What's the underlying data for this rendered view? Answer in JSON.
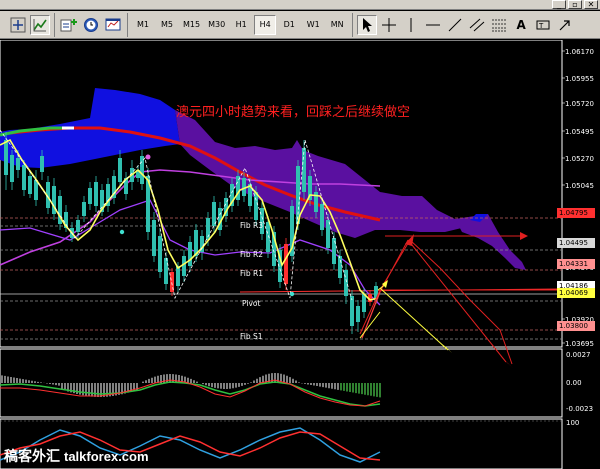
{
  "window": {
    "minimize_glyph": "_",
    "restore_glyph": "▫",
    "close_glyph": "✕"
  },
  "toolbar": {
    "icons": [
      "crosshair-box-icon",
      "line-chart-icon",
      "new-order-icon",
      "clock-icon",
      "template-icon"
    ],
    "timeframes": [
      "M1",
      "M5",
      "M15",
      "M30",
      "H1",
      "H4",
      "D1",
      "W1",
      "MN"
    ],
    "active_timeframe": "H4",
    "tools": [
      "cursor-icon",
      "crosshair-icon",
      "vertical-line-icon",
      "horizontal-line-icon",
      "trendline-icon",
      "channel-icon",
      "fibo-icon",
      "text-icon",
      "label-icon",
      "arrow-icon"
    ]
  },
  "chart": {
    "headline": "澳元四小时趋势来看，回踩之后继续做空",
    "price_labels": [
      "1.06170",
      "1.05955",
      "1.05720",
      "1.05495",
      "1.05270",
      "1.05045",
      "1.04820",
      "1.04595",
      "1.04370",
      "1.04145",
      "1.03920",
      "1.03695"
    ],
    "tagged_prices": [
      {
        "value": "1.04795",
        "bg": "#ff3030"
      },
      {
        "value": "1.04495",
        "bg": "#d8d8d8"
      },
      {
        "value": "1.04331",
        "bg": "#ff9090"
      },
      {
        "value": "1.04186",
        "bg": "#ffffff"
      },
      {
        "value": "1.04069",
        "bg": "#ffff40"
      },
      {
        "value": "1.03800",
        "bg": "#ff9090"
      }
    ],
    "levels": [
      {
        "name": "Fib R3"
      },
      {
        "name": "Fib R2"
      },
      {
        "name": "Fib R1"
      },
      {
        "name": "Pivot"
      },
      {
        "name": "Fib S1"
      }
    ],
    "macd_labels": [
      "0.0027",
      "0.00",
      "-0.0023"
    ],
    "stoch_label": "100"
  },
  "watermark": {
    "cn": "稿客外汇",
    "en": "talkforex.com"
  },
  "colors": {
    "bg": "#000000",
    "cloud_blue": "#1010e0",
    "cloud_purple": "#5a10a0",
    "ma_red": "#e01010",
    "ma_yellow": "#ffff60",
    "ma_magenta": "#c040e0",
    "candle": "#30c0b0",
    "bear_candle": "#ff2020",
    "grid": "#808080",
    "arrow_red": "#e02020",
    "arrow_yellow": "#ffff40"
  }
}
